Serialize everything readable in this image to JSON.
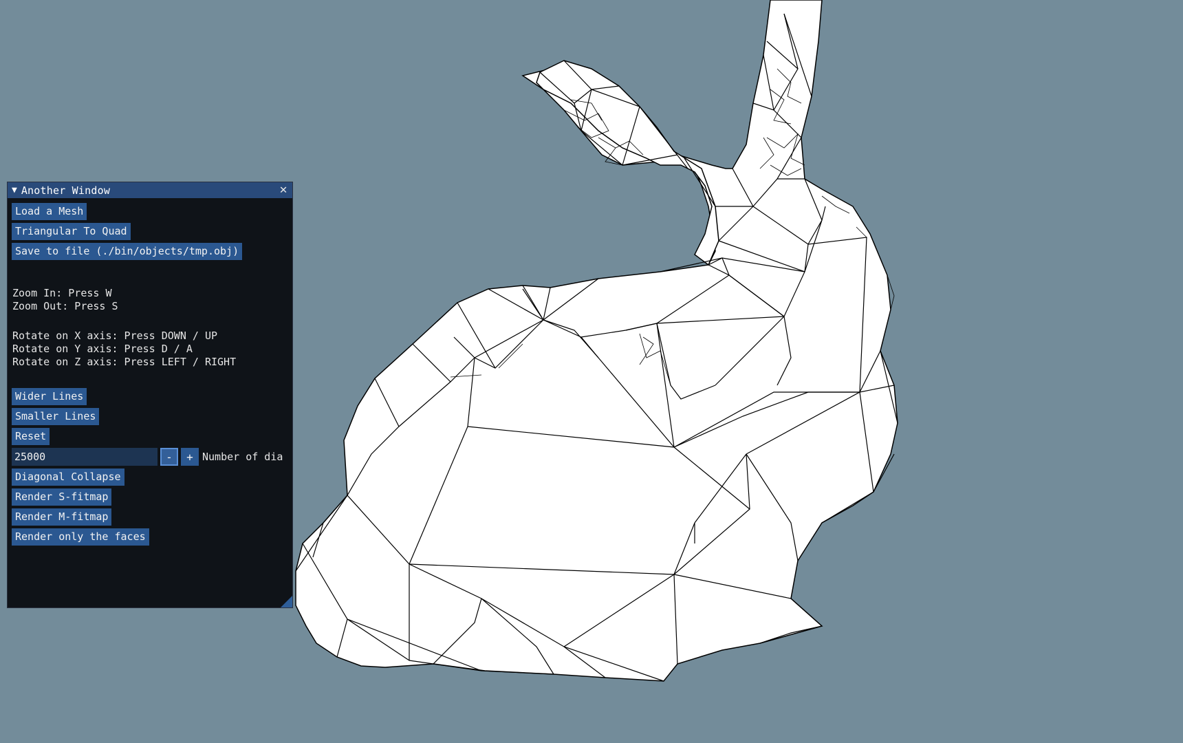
{
  "background_color": "#738c9a",
  "window": {
    "title": "Another Window",
    "collapse_icon": "triangle-down-icon",
    "close_icon": "close-icon",
    "title_bar_color": "#294a7a",
    "button_color": "#2b5891"
  },
  "buttons_top": {
    "load_mesh": "Load a Mesh",
    "tri_to_quad": "Triangular To Quad",
    "save": "Save to file (./bin/objects/tmp.obj)"
  },
  "help": {
    "zoom_in": "Zoom In: Press W",
    "zoom_out": "Zoom Out: Press S",
    "rotate_x": "Rotate on X axis: Press DOWN / UP",
    "rotate_y": "Rotate on Y axis: Press D / A",
    "rotate_z": "Rotate on Z axis: Press LEFT / RIGHT"
  },
  "buttons_lines": {
    "wider": "Wider Lines",
    "smaller": "Smaller Lines",
    "reset": "Reset"
  },
  "diagonals": {
    "value": "25000",
    "minus": "-",
    "plus": "+",
    "label": "Number of dia"
  },
  "buttons_bottom": {
    "diagonal_collapse": "Diagonal Collapse",
    "render_s": "Render S-fitmap",
    "render_m": "Render M-fitmap",
    "render_faces": "Render only the faces"
  }
}
